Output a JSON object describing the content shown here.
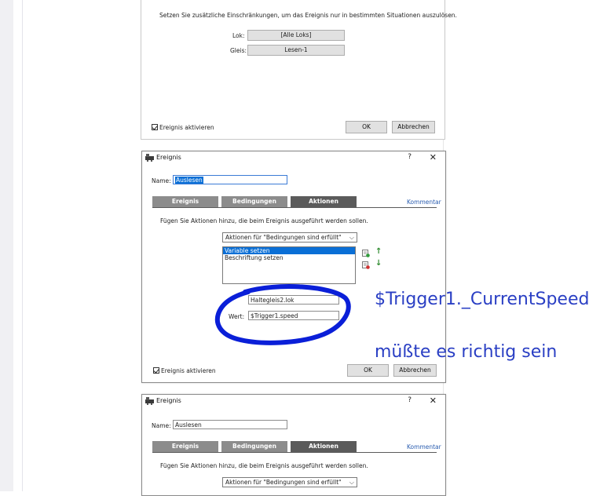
{
  "top_panel": {
    "info_text": "Setzen Sie zusätzliche Einschränkungen, um das Ereignis nur in bestimmten Situationen auszulösen.",
    "lok_label": "Lok:",
    "lok_value": "[Alle Loks]",
    "gleis_label": "Gleis:",
    "gleis_value": "Lesen-1",
    "checkbox_label": "Ereignis aktivieren",
    "ok_label": "OK",
    "cancel_label": "Abbrechen"
  },
  "dialog1": {
    "title": "Ereignis",
    "help": "?",
    "close": "✕",
    "name_label": "Name:",
    "name_value": "Auslesen",
    "tabs": [
      "Ereignis",
      "Bedingungen",
      "Aktionen"
    ],
    "comment_link": "Kommentar",
    "info_text": "Fügen Sie Aktionen hinzu, die beim Ereignis ausgeführt werden sollen.",
    "dropdown_value": "Aktionen für \"Bedingungen sind erfüllt\"",
    "list_items": [
      "Variable setzen",
      "Beschriftung setzen"
    ],
    "var_value": "Haltegleis2.lok",
    "wert_label": "Wert:",
    "wert_value": "$Trigger1.speed",
    "checkbox_label": "Ereignis aktivieren",
    "ok_label": "OK",
    "cancel_label": "Abbrechen"
  },
  "dialog2": {
    "title": "Ereignis",
    "help": "?",
    "close": "✕",
    "name_label": "Name:",
    "name_value": "Auslesen",
    "tabs": [
      "Ereignis",
      "Bedingungen",
      "Aktionen"
    ],
    "comment_link": "Kommentar",
    "info_text": "Fügen Sie Aktionen hinzu, die beim Ereignis ausgeführt werden sollen.",
    "dropdown_value": "Aktionen für \"Bedingungen sind erfüllt\""
  },
  "annotations": {
    "line1": "$Trigger1._CurrentSpeed",
    "line2": "müßte es richtig sein"
  },
  "colors": {
    "annotation_blue": "#2a3fc4",
    "circle_blue": "#0a1fd8",
    "selection_blue": "#0a6fd6",
    "tab_gray": "#8c8c8c",
    "tab_active": "#5b5b5b"
  }
}
